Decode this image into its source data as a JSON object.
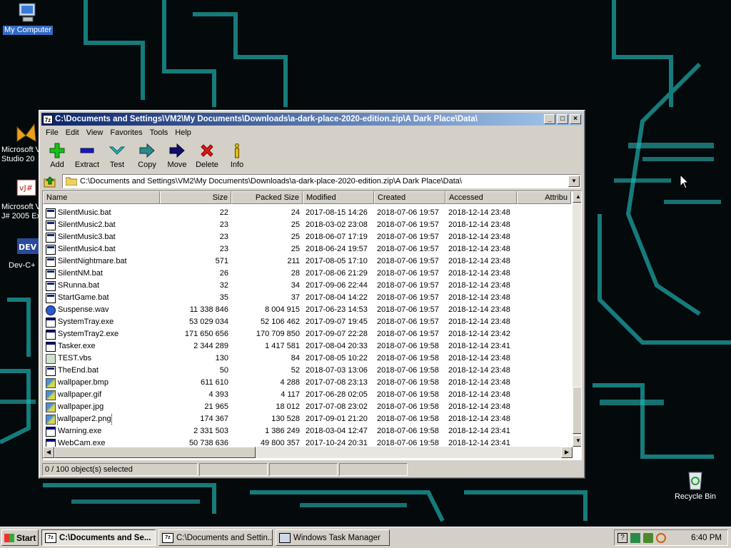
{
  "desktop": {
    "icons": [
      {
        "label": "My Computer"
      },
      {
        "label": "Microsoft V",
        "label2": "Studio 20"
      },
      {
        "label": "Microsoft V",
        "label2": "J# 2005 Ex"
      },
      {
        "label": "Dev-C+"
      },
      {
        "label": "Recycle Bin"
      }
    ]
  },
  "window": {
    "title": "C:\\Documents and Settings\\VM2\\My Documents\\Downloads\\a-dark-place-2020-edition.zip\\A Dark Place\\Data\\",
    "app_icon": "7z",
    "menu": [
      "File",
      "Edit",
      "View",
      "Favorites",
      "Tools",
      "Help"
    ],
    "toolbar": [
      {
        "label": "Add",
        "icon": "plus-icon",
        "color": "#18c018"
      },
      {
        "label": "Extract",
        "icon": "minus-icon",
        "color": "#1818c0"
      },
      {
        "label": "Test",
        "icon": "check-icon",
        "color": "#20c0c0"
      },
      {
        "label": "Copy",
        "icon": "copy-arrow-icon",
        "color": "#2a8a8a"
      },
      {
        "label": "Move",
        "icon": "move-arrow-icon",
        "color": "#10106a"
      },
      {
        "label": "Delete",
        "icon": "x-icon",
        "color": "#e01818"
      },
      {
        "label": "Info",
        "icon": "info-icon",
        "color": "#e0c000"
      }
    ],
    "address": "C:\\Documents and Settings\\VM2\\My Documents\\Downloads\\a-dark-place-2020-edition.zip\\A Dark Place\\Data\\",
    "columns": [
      "Name",
      "Size",
      "Packed Size",
      "Modified",
      "Created",
      "Accessed",
      "Attribu"
    ],
    "files": [
      {
        "name": "SilentMusic.bat",
        "type": "bat",
        "size": "22",
        "packed": "24",
        "modified": "2017-08-15 14:26",
        "created": "2018-07-06 19:57",
        "accessed": "2018-12-14 23:48"
      },
      {
        "name": "SilentMusic2.bat",
        "type": "bat",
        "size": "23",
        "packed": "25",
        "modified": "2018-03-02 23:08",
        "created": "2018-07-06 19:57",
        "accessed": "2018-12-14 23:48"
      },
      {
        "name": "SilentMusic3.bat",
        "type": "bat",
        "size": "23",
        "packed": "25",
        "modified": "2018-06-07 17:19",
        "created": "2018-07-06 19:57",
        "accessed": "2018-12-14 23:48"
      },
      {
        "name": "SilentMusic4.bat",
        "type": "bat",
        "size": "23",
        "packed": "25",
        "modified": "2018-06-24 19:57",
        "created": "2018-07-06 19:57",
        "accessed": "2018-12-14 23:48"
      },
      {
        "name": "SilentNightmare.bat",
        "type": "bat",
        "size": "571",
        "packed": "211",
        "modified": "2017-08-05 17:10",
        "created": "2018-07-06 19:57",
        "accessed": "2018-12-14 23:48"
      },
      {
        "name": "SilentNM.bat",
        "type": "bat",
        "size": "26",
        "packed": "28",
        "modified": "2017-08-06 21:29",
        "created": "2018-07-06 19:57",
        "accessed": "2018-12-14 23:48"
      },
      {
        "name": "SRunna.bat",
        "type": "bat",
        "size": "32",
        "packed": "34",
        "modified": "2017-09-06 22:44",
        "created": "2018-07-06 19:57",
        "accessed": "2018-12-14 23:48"
      },
      {
        "name": "StartGame.bat",
        "type": "bat",
        "size": "35",
        "packed": "37",
        "modified": "2017-08-04 14:22",
        "created": "2018-07-06 19:57",
        "accessed": "2018-12-14 23:48"
      },
      {
        "name": "Suspense.wav",
        "type": "wav",
        "size": "11 338 846",
        "packed": "8 004 915",
        "modified": "2017-06-23 14:53",
        "created": "2018-07-06 19:57",
        "accessed": "2018-12-14 23:48"
      },
      {
        "name": "SystemTray.exe",
        "type": "exe",
        "size": "53 029 034",
        "packed": "52 106 462",
        "modified": "2017-09-07 19:45",
        "created": "2018-07-06 19:57",
        "accessed": "2018-12-14 23:48"
      },
      {
        "name": "SystemTray2.exe",
        "type": "exe",
        "size": "171 650 656",
        "packed": "170 709 850",
        "modified": "2017-09-07 22:28",
        "created": "2018-07-06 19:57",
        "accessed": "2018-12-14 23:42"
      },
      {
        "name": "Tasker.exe",
        "type": "exe",
        "size": "2 344 289",
        "packed": "1 417 581",
        "modified": "2017-08-04 20:33",
        "created": "2018-07-06 19:58",
        "accessed": "2018-12-14 23:41"
      },
      {
        "name": "TEST.vbs",
        "type": "vbs",
        "size": "130",
        "packed": "84",
        "modified": "2017-08-05 10:22",
        "created": "2018-07-06 19:58",
        "accessed": "2018-12-14 23:48"
      },
      {
        "name": "TheEnd.bat",
        "type": "bat",
        "size": "50",
        "packed": "52",
        "modified": "2018-07-03 13:06",
        "created": "2018-07-06 19:58",
        "accessed": "2018-12-14 23:48"
      },
      {
        "name": "wallpaper.bmp",
        "type": "img",
        "size": "611 610",
        "packed": "4 288",
        "modified": "2017-07-08 23:13",
        "created": "2018-07-06 19:58",
        "accessed": "2018-12-14 23:48"
      },
      {
        "name": "wallpaper.gif",
        "type": "img",
        "size": "4 393",
        "packed": "4 117",
        "modified": "2017-06-28 02:05",
        "created": "2018-07-06 19:58",
        "accessed": "2018-12-14 23:48"
      },
      {
        "name": "wallpaper.jpg",
        "type": "img",
        "size": "21 965",
        "packed": "18 012",
        "modified": "2017-07-08 23:02",
        "created": "2018-07-06 19:58",
        "accessed": "2018-12-14 23:48"
      },
      {
        "name": "wallpaper2.png",
        "type": "img",
        "size": "174 367",
        "packed": "130 528",
        "modified": "2017-09-01 21:20",
        "created": "2018-07-06 19:58",
        "accessed": "2018-12-14 23:48",
        "focused": true
      },
      {
        "name": "Warning.exe",
        "type": "exe",
        "size": "2 331 503",
        "packed": "1 386 249",
        "modified": "2018-03-04 12:47",
        "created": "2018-07-06 19:58",
        "accessed": "2018-12-14 23:41"
      },
      {
        "name": "WebCam.exe",
        "type": "exe",
        "size": "50 738 636",
        "packed": "49 800 357",
        "modified": "2017-10-24 20:31",
        "created": "2018-07-06 19:58",
        "accessed": "2018-12-14 23:41"
      }
    ],
    "status": "0 / 100 object(s) selected"
  },
  "taskbar": {
    "start_label": "Start",
    "tasks": [
      {
        "label": "C:\\Documents and Se...",
        "icon": "7z",
        "active": true
      },
      {
        "label": "C:\\Documents and Settin...",
        "icon": "7z",
        "active": false
      },
      {
        "label": "Windows Task Manager",
        "icon": "task-manager-icon",
        "active": false
      }
    ],
    "clock": "6:40 PM"
  }
}
